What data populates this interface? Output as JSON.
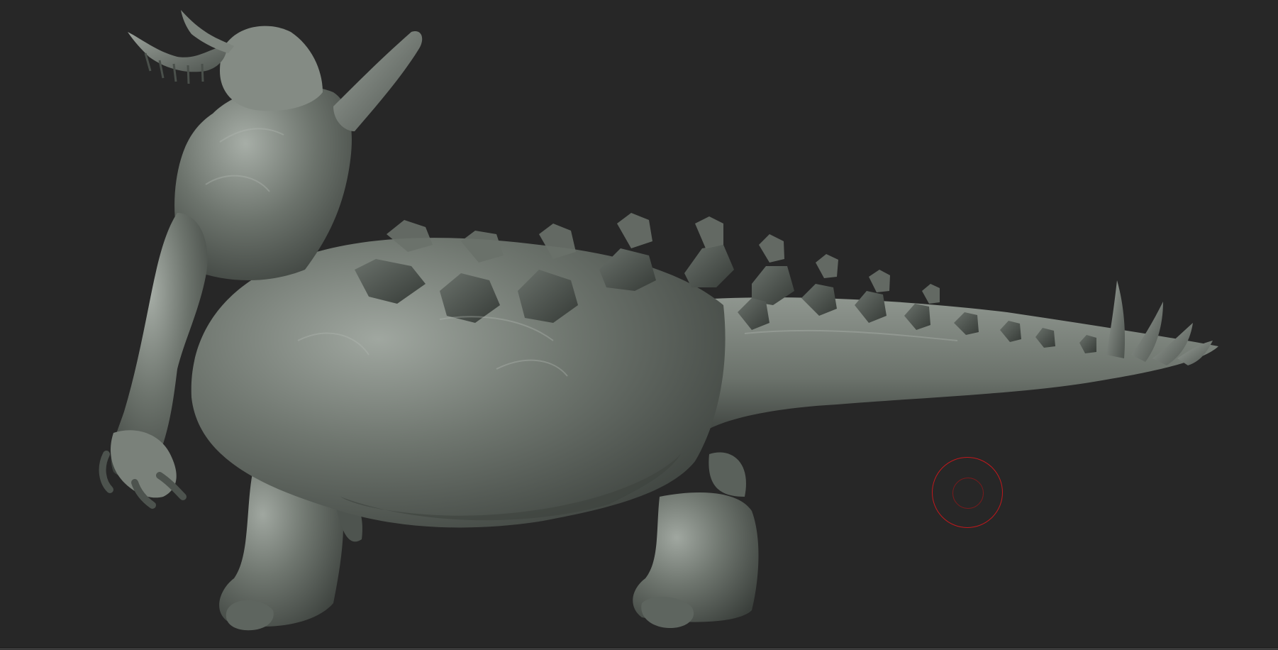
{
  "viewport": {
    "background": "#272727",
    "edge_color": "#3a3a3a"
  },
  "model": {
    "material_base": "#6f766f",
    "material_light": "#a4aaa4",
    "material_dark": "#3c413d",
    "spike_color": "#4b514c"
  },
  "brush_cursor": {
    "color": "#c0181c",
    "icon": "brush-cursor-icon"
  }
}
